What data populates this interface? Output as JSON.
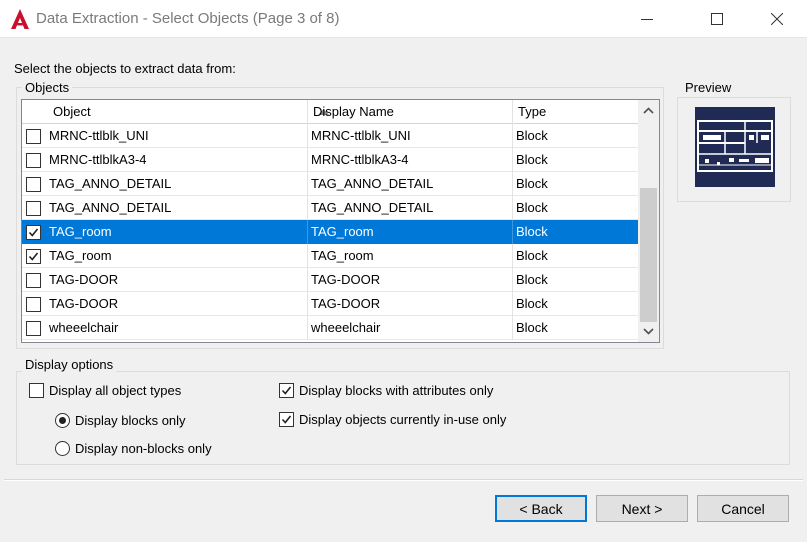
{
  "window": {
    "title": "Data Extraction - Select Objects (Page 3 of 8)",
    "app_icon": "autocad-a-icon",
    "controls": [
      "minimize-icon",
      "maximize-icon",
      "close-icon"
    ]
  },
  "instruction": "Select the objects to extract data from:",
  "objects_group": {
    "legend": "Objects",
    "columns": [
      "Object",
      "Display Name",
      "Type"
    ],
    "sorted_column": "Object",
    "rows": [
      {
        "object": "MRNC-ttlblk_UNI",
        "display_name": "MRNC-ttlblk_UNI",
        "type": "Block",
        "checked": false,
        "selected": false
      },
      {
        "object": "MRNC-ttlblkA3-4",
        "display_name": "MRNC-ttlblkA3-4",
        "type": "Block",
        "checked": false,
        "selected": false
      },
      {
        "object": "TAG_ANNO_DETAIL",
        "display_name": "TAG_ANNO_DETAIL",
        "type": "Block",
        "checked": false,
        "selected": false
      },
      {
        "object": "TAG_ANNO_DETAIL",
        "display_name": "TAG_ANNO_DETAIL",
        "type": "Block",
        "checked": false,
        "selected": false
      },
      {
        "object": "TAG_room",
        "display_name": "TAG_room",
        "type": "Block",
        "checked": true,
        "selected": true
      },
      {
        "object": "TAG_room",
        "display_name": "TAG_room",
        "type": "Block",
        "checked": true,
        "selected": false
      },
      {
        "object": "TAG-DOOR",
        "display_name": "TAG-DOOR",
        "type": "Block",
        "checked": false,
        "selected": false
      },
      {
        "object": "TAG-DOOR",
        "display_name": "TAG-DOOR",
        "type": "Block",
        "checked": false,
        "selected": false
      },
      {
        "object": "wheeelchair",
        "display_name": "wheeelchair",
        "type": "Block",
        "checked": false,
        "selected": false
      }
    ]
  },
  "preview": {
    "label": "Preview",
    "thumbnail_icon": "block-preview-icon"
  },
  "display_options": {
    "legend": "Display options",
    "display_all_object_types": {
      "label": "Display all object types",
      "checked": false
    },
    "display_blocks_only": {
      "label": "Display blocks only",
      "selected": true
    },
    "display_non_blocks_only": {
      "label": "Display non-blocks only",
      "selected": false
    },
    "display_blocks_with_attributes_only": {
      "label": "Display blocks with attributes only",
      "checked": true
    },
    "display_objects_in_use_only": {
      "label": "Display objects currently in-use only",
      "checked": true
    }
  },
  "buttons": {
    "back": "< Back",
    "next": "Next >",
    "cancel": "Cancel"
  },
  "colors": {
    "selection": "#0078d7",
    "app_icon_red": "#c8102e",
    "preview_background": "#1f2a55"
  }
}
